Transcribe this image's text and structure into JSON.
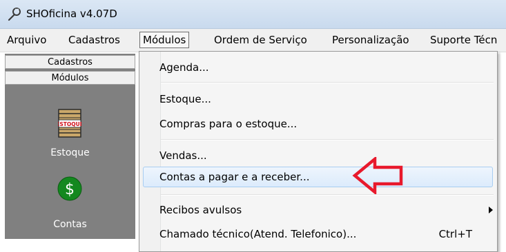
{
  "window": {
    "title": "SHOficina v4.07D"
  },
  "menubar": {
    "items": [
      {
        "label": "Arquivo"
      },
      {
        "label": "Cadastros"
      },
      {
        "label": "Módulos"
      },
      {
        "label": "Ordem de Serviço"
      },
      {
        "label": "Personalização"
      },
      {
        "label": "Suporte Técn"
      }
    ],
    "active": "Módulos"
  },
  "leftpanel": {
    "tabs": [
      {
        "label": "Cadastros"
      },
      {
        "label": "Módulos"
      }
    ],
    "modules": [
      {
        "label": "Estoque",
        "icon": "crate-icon",
        "icon_text": "ESTOQUE"
      },
      {
        "label": "Contas",
        "icon": "dollar-icon",
        "icon_text": "$"
      }
    ],
    "background_color": "#808080"
  },
  "dropdown": {
    "items": [
      {
        "label": "Agenda..."
      },
      {
        "label": "Estoque..."
      },
      {
        "label": "Compras para o estoque..."
      },
      {
        "label": "Vendas..."
      },
      {
        "label": "Contas a pagar e a receber..."
      },
      {
        "label": "Recibos avulsos",
        "submenu": true
      },
      {
        "label": "Chamado técnico(Atend. Telefonico)...",
        "shortcut": "Ctrl+T"
      }
    ],
    "highlighted": "Contas a pagar e a receber...",
    "highlight_color": "#dcebfc",
    "annotation_color": "#e8192c"
  }
}
